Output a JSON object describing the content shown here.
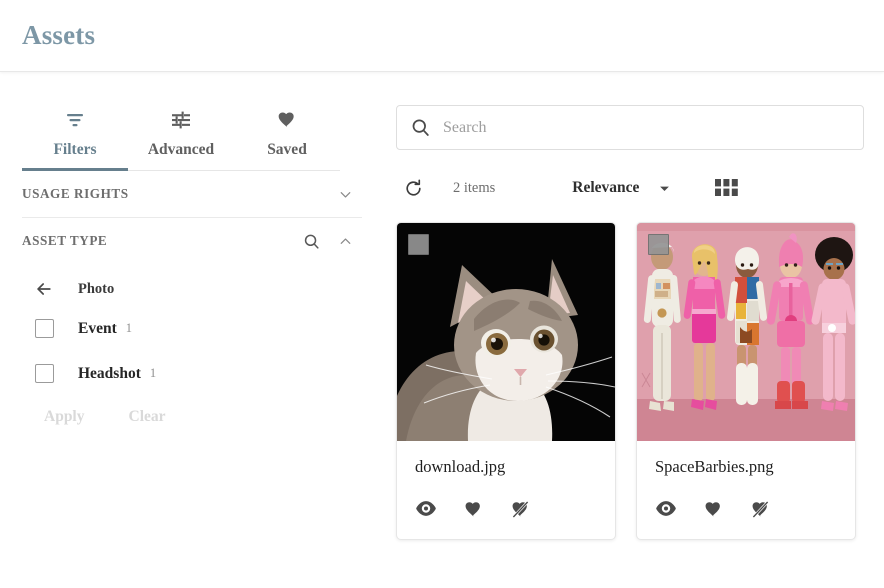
{
  "header": {
    "title": "Assets",
    "title_color": "#7d97a6"
  },
  "sidebar": {
    "tabs": [
      {
        "label": "Filters",
        "icon": "filter-icon",
        "active": true
      },
      {
        "label": "Advanced",
        "icon": "sliders-icon",
        "active": false
      },
      {
        "label": "Saved",
        "icon": "heart-icon",
        "active": false
      }
    ],
    "sections": [
      {
        "title": "USAGE RIGHTS",
        "expanded": false,
        "has_search": false,
        "chevron": "chevron-down-icon"
      },
      {
        "title": "ASSET TYPE",
        "expanded": true,
        "has_search": true,
        "chevron": "chevron-up-icon",
        "breadcrumb": {
          "label": "Photo",
          "back_icon": "arrow-left-icon"
        },
        "facets": [
          {
            "label": "Event",
            "count": "1",
            "checked": false
          },
          {
            "label": "Headshot",
            "count": "1",
            "checked": false
          }
        ],
        "actions": [
          {
            "label": "Apply",
            "disabled": true
          },
          {
            "label": "Clear",
            "disabled": true
          }
        ]
      }
    ]
  },
  "search": {
    "value": "",
    "placeholder": "Search",
    "icon": "search-icon"
  },
  "toolbar": {
    "refresh_icon": "refresh-icon",
    "item_count": "2 items",
    "sort_label": "Relevance",
    "sort_caret_icon": "caret-down-icon",
    "view_icon": "grid-view-icon"
  },
  "cards": [
    {
      "title": "download.jpg",
      "thumb": "cat-photo",
      "thumb_bg": "#050505",
      "selected": false,
      "actions": [
        {
          "name": "preview",
          "icon": "eye-icon"
        },
        {
          "name": "favorite",
          "icon": "heart-icon"
        },
        {
          "name": "unfavorite",
          "icon": "heart-slash-icon"
        }
      ]
    },
    {
      "title": "SpaceBarbies.png",
      "thumb": "barbies-photo",
      "thumb_bg": "#d98b9b",
      "selected": false,
      "actions": [
        {
          "name": "preview",
          "icon": "eye-icon"
        },
        {
          "name": "favorite",
          "icon": "heart-icon"
        },
        {
          "name": "unfavorite",
          "icon": "heart-slash-icon"
        }
      ]
    }
  ]
}
